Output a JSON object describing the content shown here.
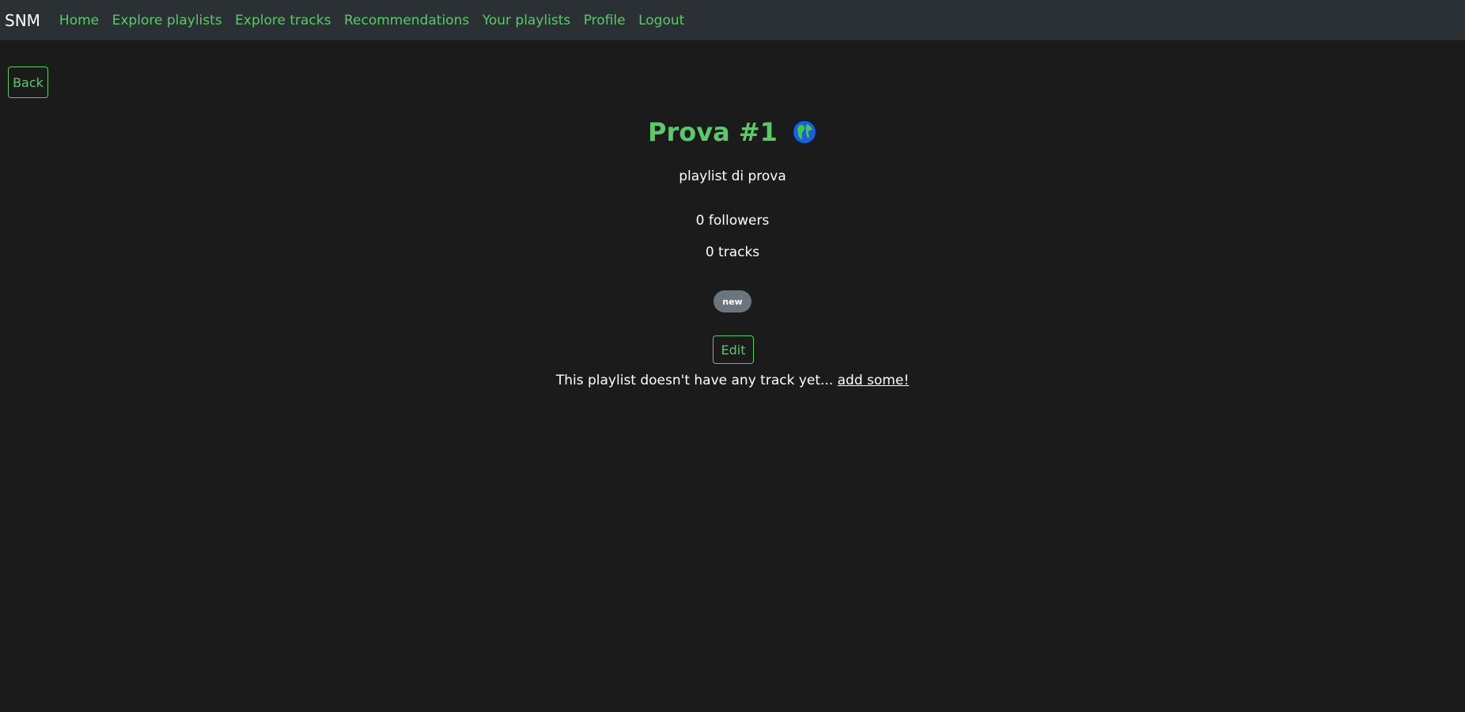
{
  "navbar": {
    "brand": "SNM",
    "links": [
      "Home",
      "Explore playlists",
      "Explore tracks",
      "Recommendations",
      "Your playlists",
      "Profile",
      "Logout"
    ]
  },
  "back_label": "Back",
  "playlist": {
    "title": "Prova #1",
    "visibility_icon": "globe-icon",
    "description": "playlist di prova",
    "followers": "0 followers",
    "tracks": "0 tracks",
    "tag": "new"
  },
  "edit_label": "Edit",
  "empty_message": {
    "text": "This playlist doesn't have any track yet... ",
    "link": "add some!"
  },
  "colors": {
    "accent": "#5cc86b",
    "navbar_bg": "#2b3035",
    "page_bg": "#1b1b1b",
    "badge_bg": "#6c757d"
  }
}
